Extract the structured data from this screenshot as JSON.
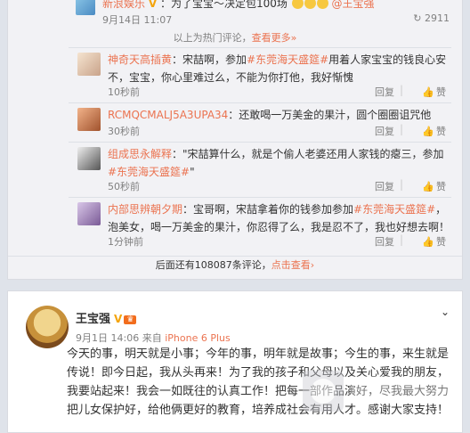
{
  "top_post": {
    "partial_line": {
      "user": "新浪娱乐",
      "text": "：为了宝宝～决定包100场",
      "mention": "@王宝强",
      "date": "9月14日 11:07",
      "share_icon": "share-icon",
      "share_count": "2911"
    },
    "hot_notice": {
      "text": "以上为热门评论，",
      "link": "查看更多»"
    },
    "comments": [
      {
        "user": "神奇天高插黄",
        "text_before": "：宋喆啊，参加",
        "hashtag": "#东莞海天盛筵#",
        "text_after": "用着人家宝宝的钱良心安不，宝宝，你心里难过么，不能为你打他，我好惭愧",
        "time": "10秒前",
        "reply": "回复",
        "like": "赞"
      },
      {
        "user": "RCMQCMALJ5A3UPA34",
        "text_before": "：还敢喝一万美金的果汁，圆个圈圈诅咒他",
        "hashtag": "",
        "text_after": "",
        "time": "30秒前",
        "reply": "回复",
        "like": "赞"
      },
      {
        "user": "组成思永解释",
        "text_before": "：\"宋喆算什么，就是个偷人老婆还用人家钱的瘪三，参加",
        "hashtag": "#东莞海天盛筵#",
        "text_after": "\"",
        "time": "50秒前",
        "reply": "回复",
        "like": "赞"
      },
      {
        "user": "内部思辨朝夕期",
        "text_before": "：宝哥啊，宋喆拿着你的钱参加参加",
        "hashtag": "#东莞海天盛筵#",
        "text_after": "，泡美女，喝一万美金的果汁，你忍得了么，我是忍不了，我也好想去啊！",
        "time": "1分钟前",
        "reply": "回复",
        "like": "赞"
      }
    ],
    "more_comments": {
      "text": "后面还有108087条评论，",
      "link": "点击查看",
      "arrow": "›"
    }
  },
  "bottom_post": {
    "author": "王宝强",
    "v_badge": "V",
    "level_badge": "♛",
    "date": "9月1日 14:06",
    "source_prefix": "来自",
    "source": "iPhone 6 Plus",
    "chevron": "chevron-down-icon",
    "body": "今天的事，明天就是小事；今年的事，明年就是故事；今生的事，来生就是传说！即今日起，我从头再来！为了我的孩子和父母以及关心爱我的朋友，我要站起来！我会一如既往的认真工作！把每一部作品演好，尽我最大努力把儿女保护好，给他俩更好的教育，培养成社会有用人才。感谢大家支持！"
  },
  "colors": {
    "accent": "#eb7350",
    "background": "#dfe3ea",
    "card": "#f2f2f5"
  }
}
